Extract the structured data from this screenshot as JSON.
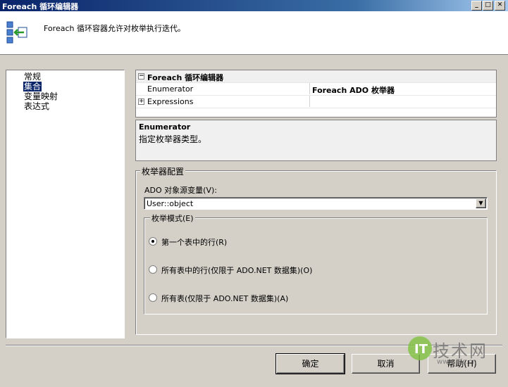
{
  "window": {
    "title": "Foreach 循环编辑器"
  },
  "header": {
    "description": "Foreach 循环容器允许对枚举执行迭代。"
  },
  "nav": {
    "items": [
      "常规",
      "集合",
      "变量映射",
      "表达式"
    ],
    "selected_index": 1
  },
  "property_grid": {
    "category": "Foreach 循环编辑器",
    "rows": [
      {
        "name": "Enumerator",
        "value": "Foreach ADO 枚举器",
        "expander": false
      },
      {
        "name": "Expressions",
        "value": "",
        "expander": true
      }
    ]
  },
  "description_box": {
    "title": "Enumerator",
    "text": "指定枚举器类型。"
  },
  "enum_config": {
    "group_title": "枚举器配置",
    "ado_label": "ADO 对象源变量(V):",
    "ado_value": "User::object",
    "mode_title": "枚举模式(E)",
    "options": [
      {
        "label": "第一个表中的行(R)",
        "checked": true
      },
      {
        "label": "所有表中的行(仅限于 ADO.NET 数据集)(O)",
        "checked": false
      },
      {
        "label": "所有表(仅限于 ADO.NET 数据集)(A)",
        "checked": false
      }
    ]
  },
  "buttons": {
    "ok": "确定",
    "cancel": "取消",
    "help": "帮助(H)"
  },
  "watermark": {
    "text": "技术网",
    "url": "www.itjs.cn"
  },
  "colors": {
    "title_start": "#0a246a",
    "title_end": "#a6caf0",
    "selection": "#0a246a",
    "face": "#d4d0c8"
  }
}
